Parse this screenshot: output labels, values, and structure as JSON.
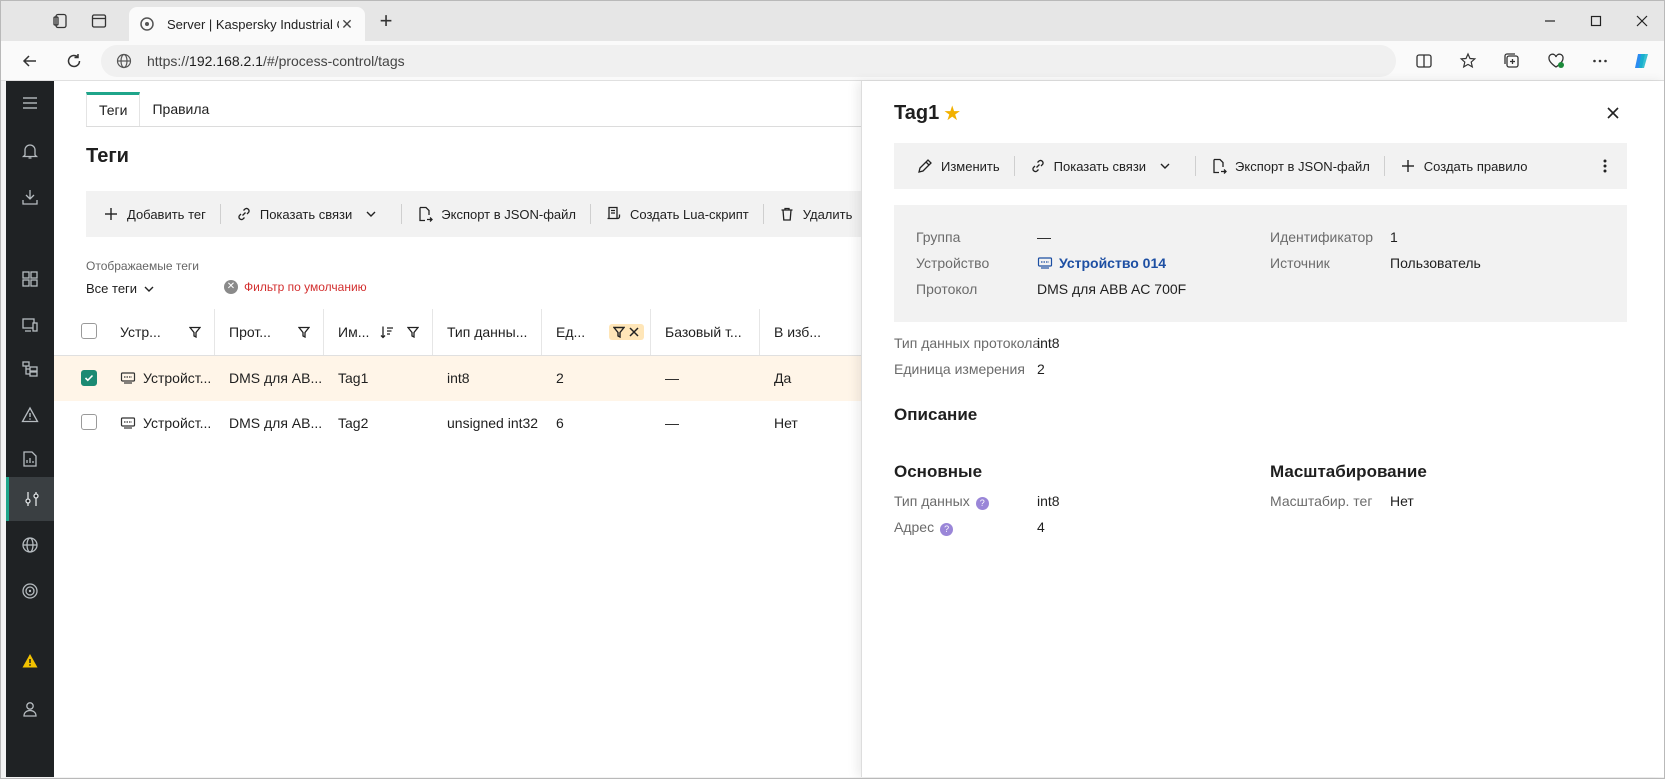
{
  "browser": {
    "tab_title": "Server | Kaspersky Industrial Cyb",
    "url_prefix": "https://",
    "url_host": "192.168.2.1",
    "url_path": "/#/process-control/tags"
  },
  "app": {
    "tabs": [
      "Теги",
      "Правила"
    ],
    "page_title": "Теги",
    "toolbar": {
      "add": "Добавить тег",
      "links": "Показать связи",
      "export": "Экспорт в JSON-файл",
      "lua": "Создать Lua-скрипт",
      "delete": "Удалить"
    },
    "filter_label": "Отображаемые теги",
    "filter_value": "Все теги",
    "filter_chip": "Фильтр по умолчанию",
    "columns": [
      "Устр...",
      "Прот...",
      "Им...",
      "Тип данны...",
      "Ед...",
      "Базовый т...",
      "В изб..."
    ],
    "rows": [
      {
        "device": "Устройст...",
        "protocol": "DMS для AB...",
        "name": "Tag1",
        "type": "int8",
        "unit": "2",
        "base": "—",
        "fav": "Да",
        "selected": true
      },
      {
        "device": "Устройст...",
        "protocol": "DMS для AB...",
        "name": "Tag2",
        "type": "unsigned int32",
        "unit": "6",
        "base": "—",
        "fav": "Нет",
        "selected": false
      }
    ]
  },
  "panel": {
    "title": "Tag1",
    "toolbar": {
      "edit": "Изменить",
      "links": "Показать связи",
      "export": "Экспорт в JSON-файл",
      "rule": "Создать правило"
    },
    "info": {
      "group_k": "Группа",
      "group_v": "—",
      "device_k": "Устройство",
      "device_v": "Устройство 014",
      "protocol_k": "Протокол",
      "protocol_v": "DMS для ABB AC 700F",
      "id_k": "Идентификатор",
      "id_v": "1",
      "source_k": "Источник",
      "source_v": "Пользователь"
    },
    "proto_type_k": "Тип данных протокола",
    "proto_type_v": "int8",
    "unit_k": "Единица измерения",
    "unit_v": "2",
    "description_title": "Описание",
    "basic_title": "Основные",
    "data_type_k": "Тип данных",
    "data_type_v": "int8",
    "address_k": "Адрес",
    "address_v": "4",
    "scaling_title": "Масштабирование",
    "scaling_tag_k": "Масштабир. тег",
    "scaling_tag_v": "Нет"
  }
}
